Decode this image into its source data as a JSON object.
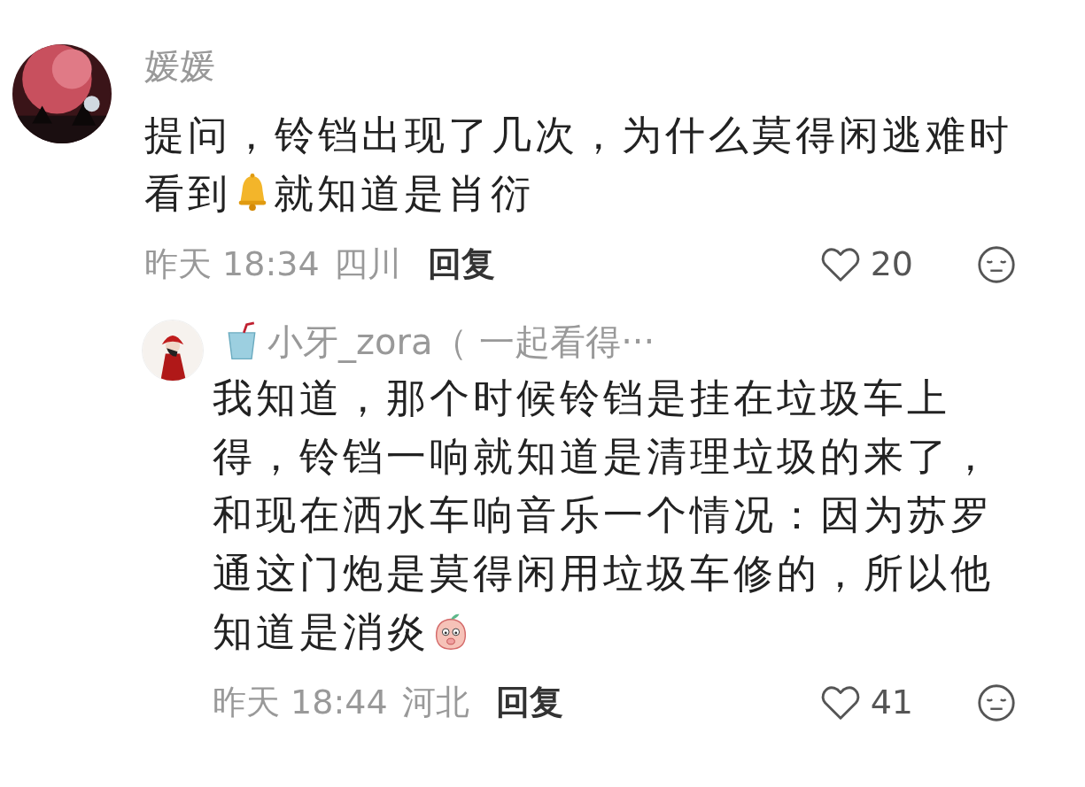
{
  "comments": [
    {
      "avatar": {
        "kind": "picture"
      },
      "badge": false,
      "name": "媛媛",
      "body": [
        {
          "kind": "line",
          "text": "提问，铃铛出现了几次，为什么莫得闲逃难时"
        },
        {
          "kind": "text",
          "text": "看到"
        },
        {
          "kind": "bell"
        },
        {
          "kind": "text",
          "text": "就知道是肖衍"
        }
      ],
      "time": "昨天 18:34",
      "location": "四川",
      "reply": "回复",
      "likes": "20",
      "reply_level": false
    },
    {
      "avatar": {
        "kind": "picture"
      },
      "badge": true,
      "name": "小牙_zora（ 一起看得···",
      "body": [
        {
          "kind": "line",
          "text": "我知道，那个时候铃铛是挂在垃圾车上得，铃铛一响就知道是清理垃圾的来了，和现在洒水车响音乐一个情况：因为苏罗通这门炮是莫得闲用垃圾车修的，所以他"
        },
        {
          "kind": "text",
          "text": "知道是消炎"
        },
        {
          "kind": "peach"
        }
      ],
      "time": "昨天 18:44",
      "location": "河北",
      "reply": "回复",
      "likes": "41",
      "reply_level": true
    }
  ]
}
